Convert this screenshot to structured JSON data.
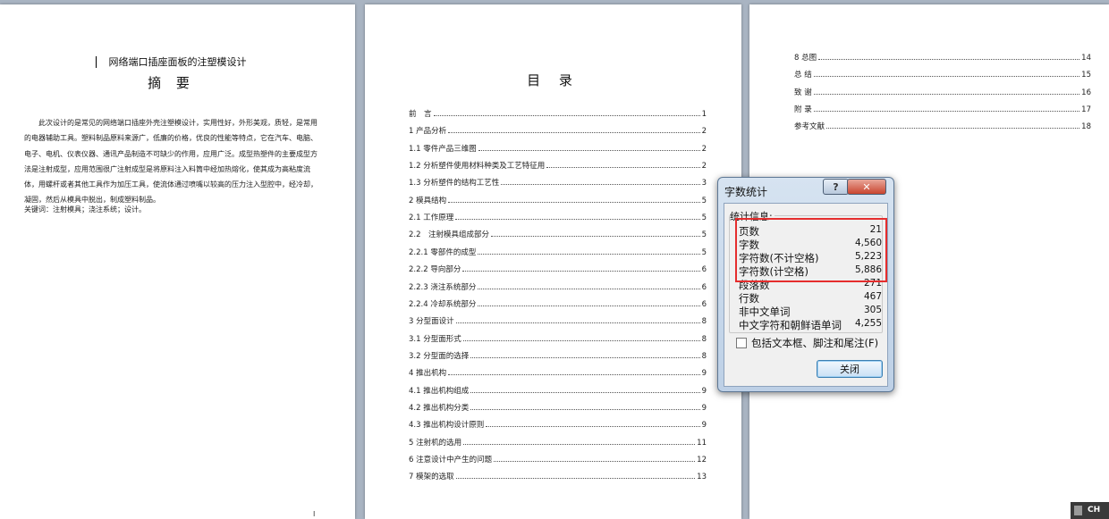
{
  "page1": {
    "title": "网络端口插座面板的注塑模设计",
    "abstract_heading": "摘 要",
    "abstract_body": "此次设计的是常见的网络端口插座外壳注塑模设计，实用性好，外形美观，质轻，是常用的电器辅助工具。塑料制品原料来源广，低廉的价格，优良的性能等特点，它在汽车、电脑、电子、电机、仪表仪器、通讯产品制造不可缺少的作用，应用广泛。成型热塑件的主要成型方法是注射成型，应用范围很广注射成型是将原料注入料筒中经加热熔化，使其成为高粘度流体，用螺杆或者其他工具作为加压工具，使流体通过喷嘴以较高的压力注入型腔中，经冷却，凝固，然后从模具中脱出，制成塑料制品。",
    "keywords": "关键词：注射模具；浇注系统；设计。",
    "page_number": "I"
  },
  "page2": {
    "toc_title": "目 录",
    "entries": [
      {
        "text": "前　言",
        "page": "1"
      },
      {
        "text": "1 产品分析",
        "page": "2"
      },
      {
        "text": "1.1 零件产品三维图",
        "page": "2"
      },
      {
        "text": "1.2 分析塑件使用材料种类及工艺特征用",
        "page": "2"
      },
      {
        "text": "1.3 分析塑件的结构工艺性",
        "page": "3"
      },
      {
        "text": "2 模具结构",
        "page": "5"
      },
      {
        "text": "2.1 工作原理",
        "page": "5"
      },
      {
        "text": "2.2　注射模具组成部分",
        "page": "5"
      },
      {
        "text": "2.2.1 零部件的成型",
        "page": "5"
      },
      {
        "text": "2.2.2 导向部分",
        "page": "6"
      },
      {
        "text": "2.2.3 浇注系统部分",
        "page": "6"
      },
      {
        "text": "2.2.4 冷却系统部分",
        "page": "6"
      },
      {
        "text": "3 分型面设计",
        "page": "8"
      },
      {
        "text": "3.1 分型面形式",
        "page": "8"
      },
      {
        "text": "3.2 分型面的选择",
        "page": "8"
      },
      {
        "text": "4 推出机构",
        "page": "9"
      },
      {
        "text": "4.1 推出机构组成",
        "page": "9"
      },
      {
        "text": "4.2 推出机构分类",
        "page": "9"
      },
      {
        "text": "4.3 推出机构设计原则",
        "page": "9"
      },
      {
        "text": "5 注射机的选用",
        "page": "11"
      },
      {
        "text": "6 注意设计中产生的问题",
        "page": "12"
      },
      {
        "text": "7 模架的选取",
        "page": "13"
      }
    ]
  },
  "page3": {
    "entries": [
      {
        "text": "8 总图",
        "page": "14"
      },
      {
        "text": "总 结",
        "page": "15"
      },
      {
        "text": "致 谢",
        "page": "16"
      },
      {
        "text": "附 录",
        "page": "17"
      },
      {
        "text": "参考文献",
        "page": "18"
      }
    ]
  },
  "dialog": {
    "title": "字数统计",
    "help": "?",
    "close_x": "✕",
    "group_label": "统计信息:",
    "stats": [
      {
        "label": "页数",
        "value": "21"
      },
      {
        "label": "字数",
        "value": "4,560"
      },
      {
        "label": "字符数(不计空格)",
        "value": "5,223"
      },
      {
        "label": "字符数(计空格)",
        "value": "5,886"
      },
      {
        "label": "段落数",
        "value": "271"
      },
      {
        "label": "行数",
        "value": "467"
      },
      {
        "label": "非中文单词",
        "value": "305"
      },
      {
        "label": "中文字符和朝鲜语单词",
        "value": "4,255"
      }
    ],
    "checkbox_label": "包括文本框、脚注和尾注(F)",
    "close_button": "关闭",
    "highlight_color": "#e52d2d"
  },
  "taskbar": {
    "ime_label": "CH"
  }
}
